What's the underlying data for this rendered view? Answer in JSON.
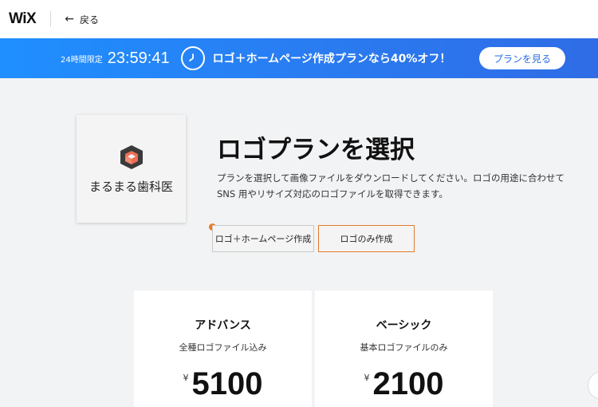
{
  "header": {
    "logo_text": "WiX",
    "back_label": "戻る"
  },
  "banner": {
    "timer_label": "24時間限定",
    "timer_value": "23:59:41",
    "offer_text": "ロゴ＋ホームページ作成プランなら40%オフ！",
    "cta_label": "プランを見る",
    "colors": {
      "start": "#1f8fff",
      "end": "#2f6ce6"
    }
  },
  "brand_preview": {
    "name": "まるまる歯科医"
  },
  "main": {
    "title": "ロゴプランを選択",
    "description": "プランを選択して画像ファイルをダウンロードしてください。ロゴの用途に合わせて SNS 用やリサイズ対応のロゴファイルを取得できます。",
    "tabs": [
      {
        "label": "ロゴ＋ホームページ作成",
        "selected": false
      },
      {
        "label": "ロゴのみ作成",
        "selected": true
      }
    ]
  },
  "plans": [
    {
      "name": "アドバンス",
      "subtitle": "全種ロゴファイル込み",
      "currency": "¥",
      "price": "5100"
    },
    {
      "name": "ベーシック",
      "subtitle": "基本ロゴファイルのみ",
      "currency": "¥",
      "price": "2100"
    }
  ],
  "accent_color": "#e27a2c"
}
